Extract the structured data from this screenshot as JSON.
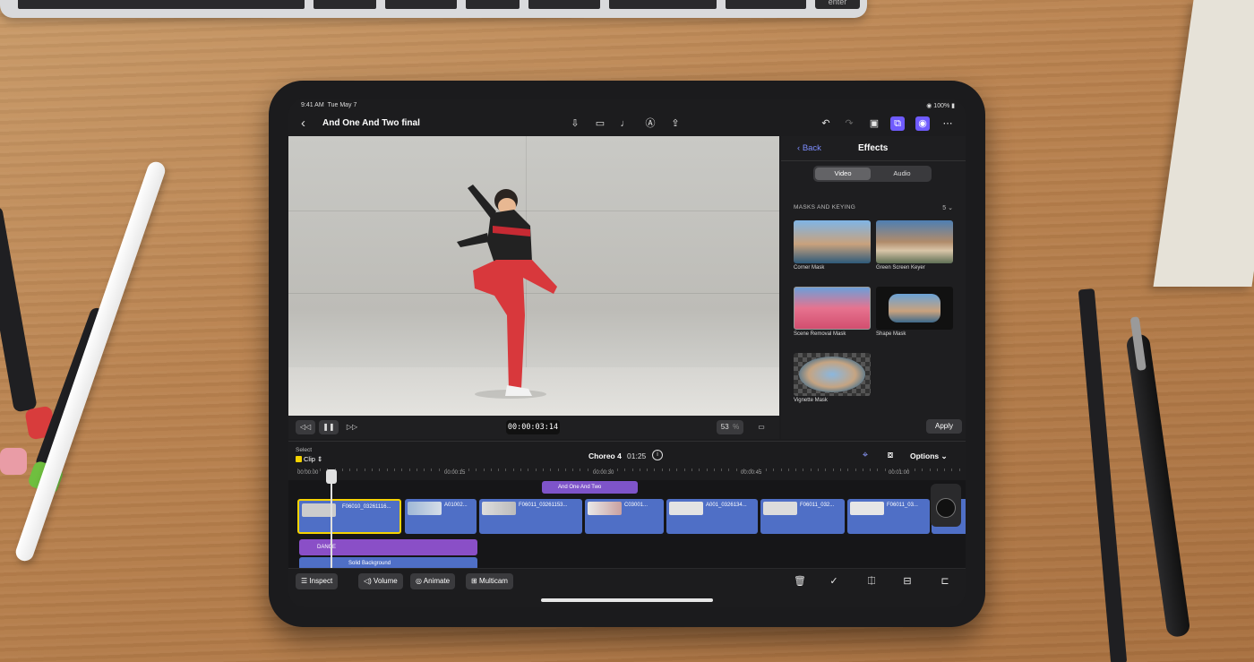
{
  "status": {
    "time": "9:41 AM",
    "date": "Tue May 7",
    "battery": "100%"
  },
  "project": {
    "title": "And One And Two final"
  },
  "toolbar": {
    "icons": [
      "import-icon",
      "camera-icon",
      "microphone-icon",
      "live-drawing-icon",
      "share-icon",
      "undo-icon",
      "redo-icon",
      "photos-icon",
      "browser-icon",
      "inspector-icon",
      "more-icon"
    ]
  },
  "viewer": {
    "timecode": "00:00:03:14",
    "zoom": "53",
    "zoom_unit": "%"
  },
  "effects": {
    "back_label": "Back",
    "title": "Effects",
    "tabs": [
      "Video",
      "Audio"
    ],
    "active_tab": "Video",
    "section": "MASKS AND KEYING",
    "count": "5",
    "items": [
      {
        "label": "Corner Mask"
      },
      {
        "label": "Green Screen Keyer"
      },
      {
        "label": "Scene Removal Mask"
      },
      {
        "label": "Shape Mask"
      },
      {
        "label": "Vignette Mask"
      }
    ],
    "apply_label": "Apply"
  },
  "timeline": {
    "select_label": "Select",
    "select_value": "Clip",
    "project_name": "Choreo 4",
    "duration": "01:25",
    "options_label": "Options",
    "ruler": [
      "00:00:00",
      "00:00:15",
      "00:00:30",
      "00:00:45",
      "00:01:00"
    ],
    "title_clip": "And One And Two",
    "clips": [
      "F06010_03261116...",
      "A01002...",
      "F06011_03261153...",
      "C03001...",
      "A001_0326134...",
      "F06011_032...",
      "F06011_03..."
    ],
    "dance_label": "DANCE",
    "solid_label": "Solid Background"
  },
  "bottombar": {
    "inspect": "Inspect",
    "volume": "Volume",
    "animate": "Animate",
    "multicam": "Multicam"
  },
  "colors": {
    "accent": "#6f5bff",
    "clip_blue": "#4f6fc6",
    "title_purple": "#7e54c9",
    "selection_yellow": "#f5d300"
  }
}
